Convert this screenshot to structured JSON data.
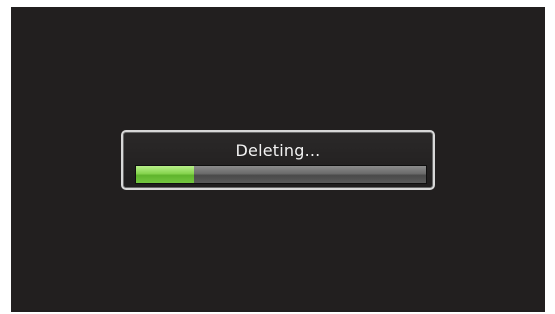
{
  "dialog": {
    "status_text": "Deleting...",
    "progress_fraction": 0.2
  },
  "colors": {
    "screen_background": "#221f1f",
    "progress_fill": "#86d44e",
    "progress_track": "#6b6b6b",
    "dialog_border": "#d8d8d8",
    "text": "#f2f2f2"
  }
}
